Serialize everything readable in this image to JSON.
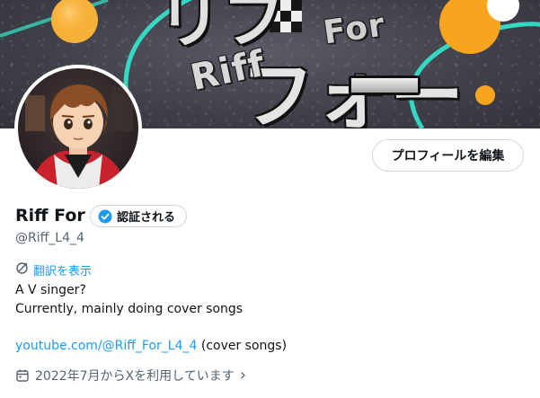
{
  "banner": {
    "logo_text_riff": "Riff",
    "logo_text_for": "For",
    "logo_text_big": "フォー",
    "logo_text_top": "リフ",
    "accent_orange": "#f7a51f",
    "accent_teal": "#2ee6c8"
  },
  "profile": {
    "name": "Riff For",
    "verify_label": "認証される",
    "handle": "@Riff_L4_4",
    "edit_button_label": "プロフィールを編集",
    "translate_label": "翻訳を表示",
    "bio_line1": "A V singer?",
    "bio_line2": "Currently, mainly doing cover songs",
    "link_text": "youtube.com/@Riff_For_L4_4",
    "link_suffix": " (cover songs)",
    "joined_text": "2022年7月からXを利用しています",
    "joined_chevron": "›"
  },
  "colors": {
    "link_blue": "#1d9bf0",
    "text_primary": "#0f1419",
    "text_secondary": "#536471",
    "border": "#cfd9de"
  },
  "icons": {
    "verify": "verified-badge-icon",
    "translate": "translate-icon",
    "calendar": "calendar-icon",
    "chevron": "chevron-right-icon"
  }
}
